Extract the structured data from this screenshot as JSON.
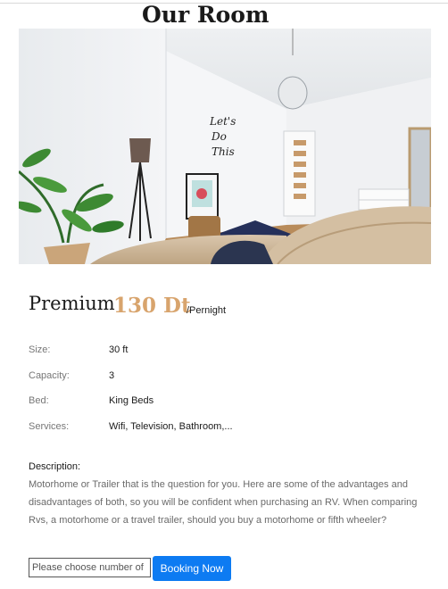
{
  "page": {
    "title": "Our Room"
  },
  "room": {
    "name": "Premium",
    "price": "130 Dt",
    "per": "/Pernight",
    "details": [
      {
        "label": "Size:",
        "value": "30 ft"
      },
      {
        "label": "Capacity:",
        "value": "3"
      },
      {
        "label": "Bed:",
        "value": "King Beds"
      },
      {
        "label": "Services:",
        "value": "Wifi, Television, Bathroom,..."
      }
    ],
    "description_label": "Description:",
    "description": "Motorhome or Trailer that is the question for you. Here are some of the advantages and disadvantages of both, so you will be confident when purchasing an RV. When comparing Rvs, a motorhome or a travel trailer, should you buy a motorhome or fifth wheeler?"
  },
  "poster_text": "Let's Do This",
  "booking": {
    "placeholder": "Please choose number of",
    "button_label": "Booking Now"
  },
  "colors": {
    "price_accent": "#d8a46d",
    "button_blue": "#0d7bf2"
  }
}
